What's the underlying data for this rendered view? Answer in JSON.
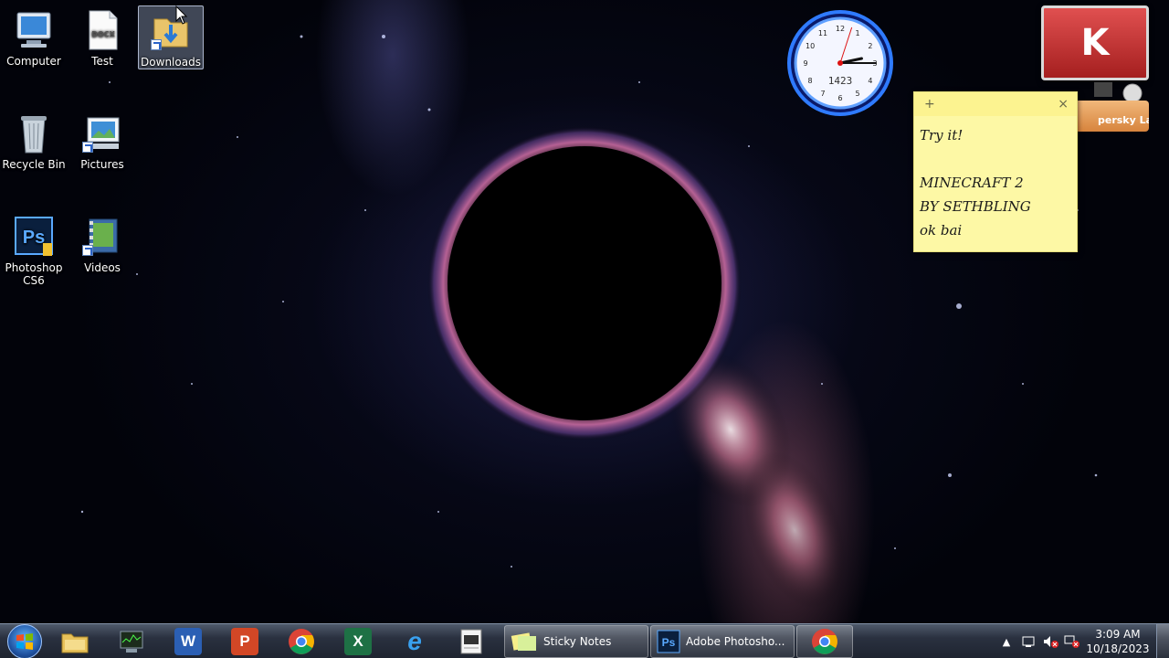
{
  "desktop": {
    "icons": [
      {
        "label": "Computer",
        "icon": "computer-icon"
      },
      {
        "label": "Test",
        "icon": "docx-file-icon"
      },
      {
        "label": "Downloads",
        "icon": "downloads-folder-icon",
        "selected": true
      },
      {
        "label": "Recycle Bin",
        "icon": "recycle-bin-icon"
      },
      {
        "label": "Pictures",
        "icon": "pictures-icon"
      },
      {
        "label": "Photoshop CS6",
        "icon": "photoshop-icon"
      },
      {
        "label": "Videos",
        "icon": "videos-icon"
      }
    ],
    "docx_badge": "DOCX"
  },
  "gadgets": {
    "clock": {
      "digital_text": "1423",
      "numbers": [
        "12",
        "1",
        "2",
        "3",
        "4",
        "5",
        "6",
        "7",
        "8",
        "9",
        "10",
        "11"
      ],
      "hour_hand_value": 2.6,
      "minute_hand_value": 15,
      "second_hand_value": 3
    },
    "kaspersky": {
      "logo": "K",
      "label": "persky Lab"
    }
  },
  "sticky_note": {
    "add_glyph": "+",
    "close_glyph": "×",
    "lines": [
      "Try it!",
      "",
      "MINECRAFT 2",
      "BY SETHBLING",
      "ok bai"
    ]
  },
  "taskbar": {
    "pinned": [
      {
        "name": "file-explorer",
        "glyph": "",
        "color": "#e8c25a"
      },
      {
        "name": "task-manager",
        "glyph": "",
        "color": "#5c8a5c"
      },
      {
        "name": "word",
        "glyph": "W",
        "color": "#2b5fb4"
      },
      {
        "name": "powerpoint",
        "glyph": "P",
        "color": "#d24726"
      },
      {
        "name": "chrome",
        "glyph": "",
        "color": "#db4437"
      },
      {
        "name": "excel",
        "glyph": "X",
        "color": "#1e7145"
      },
      {
        "name": "internet-explorer",
        "glyph": "e",
        "color": "#1e8bd6"
      },
      {
        "name": "notepad",
        "glyph": "",
        "color": "#e8e8e8"
      }
    ],
    "tasks": [
      {
        "label": "Sticky Notes",
        "icon": "sticky-notes-icon"
      },
      {
        "label": "Adobe Photosho...",
        "icon": "photoshop-icon"
      },
      {
        "label": "",
        "icon": "chrome-icon"
      }
    ],
    "tray": {
      "time": "3:09 AM",
      "date": "10/18/2023"
    }
  }
}
